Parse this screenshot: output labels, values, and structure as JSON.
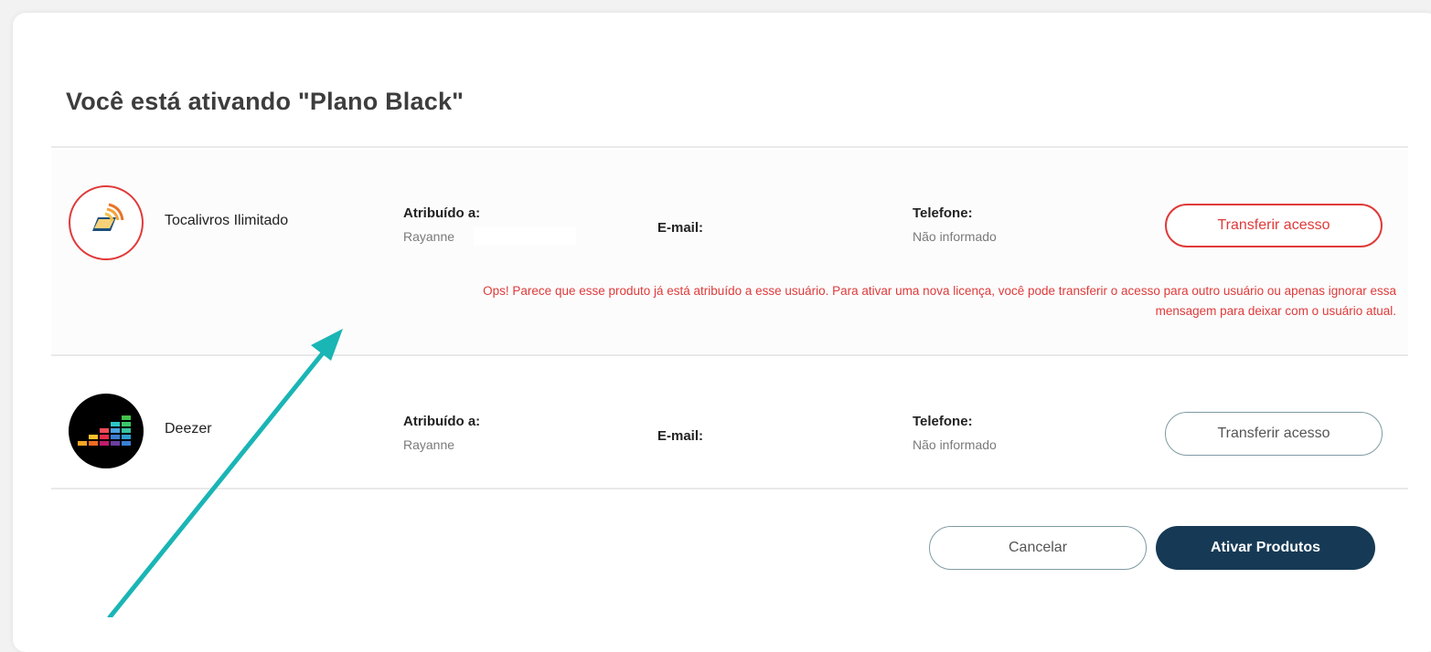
{
  "dialog": {
    "title": "Você está ativando \"Plano Black\""
  },
  "products": [
    {
      "name": "Tocalivros Ilimitado",
      "assigned_label": "Atribuído a:",
      "assigned_value": "Rayanne",
      "email_label": "E-mail:",
      "phone_label": "Telefone:",
      "phone_value": "Não informado",
      "transfer_label": "Transferir acesso",
      "error_line1": "Ops! Parece que esse produto já está atribuído a esse usuário. Para ativar uma nova licença, você pode transferir o acesso para outro usuário ou apenas ignorar essa",
      "error_line2": "mensagem para deixar com o usuário atual.",
      "icon": "tocalivros-logo-icon"
    },
    {
      "name": "Deezer",
      "assigned_label": "Atribuído a:",
      "assigned_value": "Rayanne",
      "email_label": "E-mail:",
      "phone_label": "Telefone:",
      "phone_value": "Não informado",
      "transfer_label": "Transferir acesso",
      "icon": "deezer-logo-icon"
    }
  ],
  "footer": {
    "cancel_label": "Cancelar",
    "activate_label": "Ativar Produtos"
  },
  "colors": {
    "error": "#e03a3a",
    "primary": "#163a55",
    "annotation_arrow": "#1ab5b5"
  }
}
